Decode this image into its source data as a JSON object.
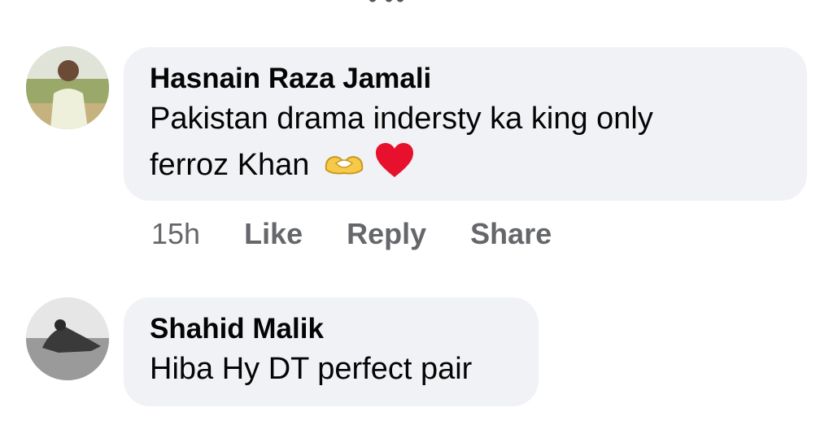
{
  "comments": [
    {
      "author": "Hasnain Raza Jamali",
      "text_line1": "Pakistan drama indersty ka king only",
      "text_line2": "ferroz Khan",
      "time": "15h",
      "like_label": "Like",
      "reply_label": "Reply",
      "share_label": "Share",
      "emojis": [
        "heart-hands-icon",
        "red-heart-icon"
      ]
    },
    {
      "author": "Shahid Malik",
      "text": "Hiba Hy DT perfect pair"
    }
  ],
  "colors": {
    "bubble_bg": "#f0f2f5",
    "action_text": "#65676b",
    "name_text": "#050505",
    "heart": "#e8112d",
    "heart_hands": "#f7c948"
  }
}
